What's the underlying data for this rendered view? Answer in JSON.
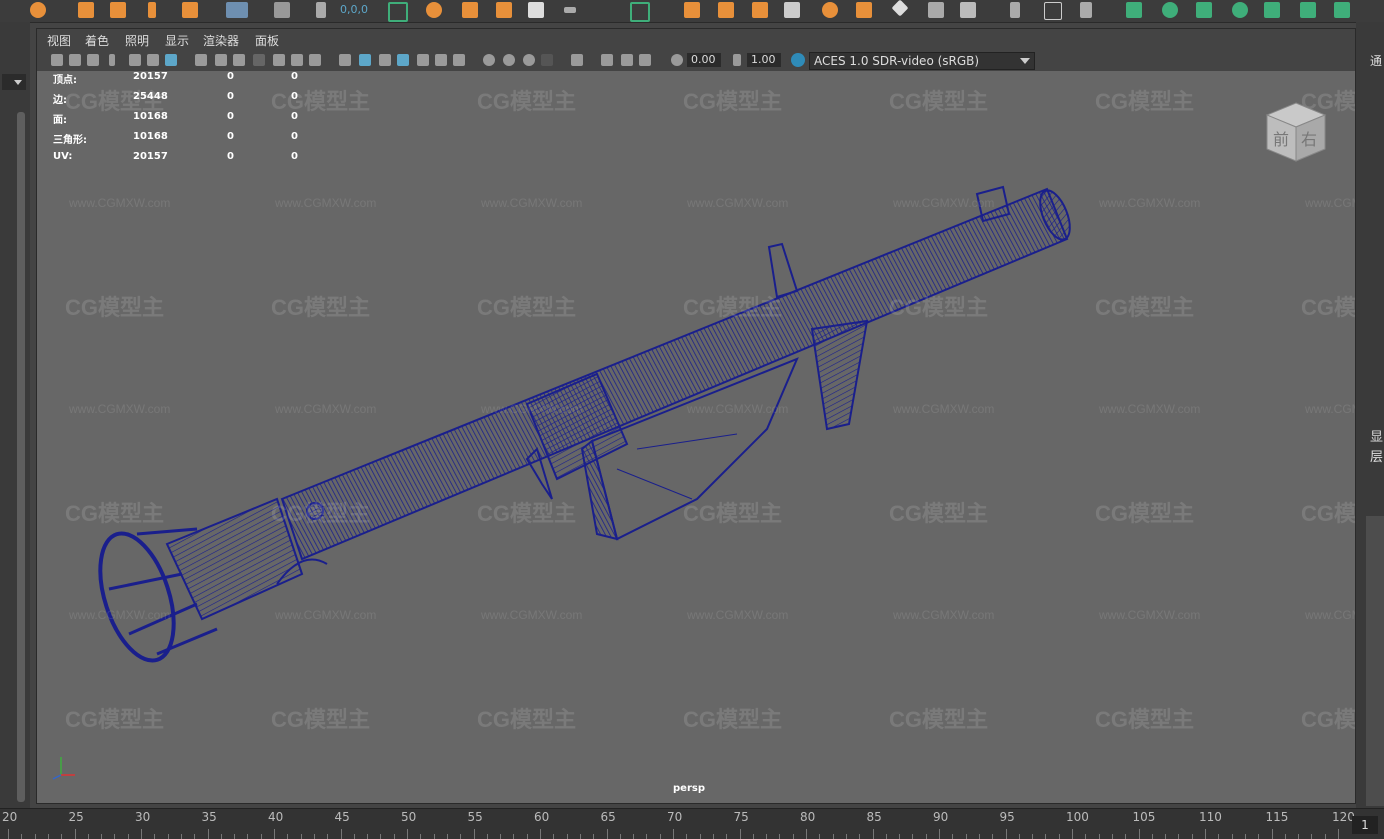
{
  "shelf": {
    "coords_label": "0,0,0",
    "right_label": "通"
  },
  "viewport": {
    "menus": [
      "视图",
      "着色",
      "照明",
      "显示",
      "渲染器",
      "面板"
    ],
    "exposure_value": "0.00",
    "gamma_value": "1.00",
    "color_space": "ACES 1.0 SDR-video (sRGB)",
    "camera_name": "persp",
    "viewcube": {
      "front": "前",
      "right": "右"
    }
  },
  "hud": {
    "rows": [
      {
        "label": "顶点:",
        "v1": "20157",
        "v2": "0",
        "v3": "0"
      },
      {
        "label": "边:",
        "v1": "25448",
        "v2": "0",
        "v3": "0"
      },
      {
        "label": "面:",
        "v1": "10168",
        "v2": "0",
        "v3": "0"
      },
      {
        "label": "三角形:",
        "v1": "10168",
        "v2": "0",
        "v3": "0"
      },
      {
        "label": "UV:",
        "v1": "20157",
        "v2": "0",
        "v3": "0"
      }
    ]
  },
  "right_panel": {
    "label1": "显",
    "label2": "层"
  },
  "watermark": {
    "brand": "CG模型主",
    "url": "www.CGMXW.com"
  },
  "timeline": {
    "ticks": [
      "20",
      "25",
      "30",
      "35",
      "40",
      "45",
      "50",
      "55",
      "60",
      "65",
      "70",
      "75",
      "80",
      "85",
      "90",
      "95",
      "100",
      "105",
      "110",
      "115",
      "120"
    ],
    "current_frame": "1"
  },
  "colors": {
    "wireframe": "#1a1f8c",
    "viewport_bg": "#676767",
    "accent_orange": "#e8903a",
    "accent_green": "#3fae7a",
    "selection_blue": "#5da7c9"
  }
}
